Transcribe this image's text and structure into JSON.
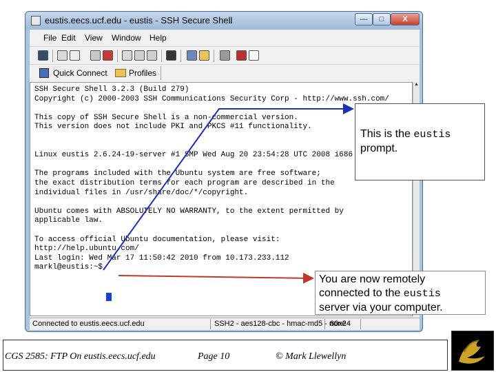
{
  "window": {
    "title": "eustis.eecs.ucf.edu - eustis - SSH Secure Shell",
    "minimize": "—",
    "maximize": "□",
    "close": "X"
  },
  "menu": [
    "File",
    "Edit",
    "View",
    "Window",
    "Help"
  ],
  "toolbar_icons": [
    "save-icon",
    "print-icon",
    "print-preview-icon",
    "search-icon",
    "shield-icon",
    "copy-icon",
    "paste-icon",
    "paste-special-icon",
    "binoculars-icon",
    "settings-icon",
    "folder-icon",
    "key-icon",
    "help-book-icon",
    "whats-this-icon"
  ],
  "linkbar": {
    "quick_connect": "Quick Connect",
    "profiles": "Profiles"
  },
  "terminal": {
    "text": "SSH Secure Shell 3.2.3 (Build 279)\nCopyright (c) 2000-2003 SSH Communications Security Corp - http://www.ssh.com/\n\nThis copy of SSH Secure Shell is a non-commercial version.\nThis version does not include PKI and PKCS #11 functionality.\n\n\nLinux eustis 2.6.24-19-server #1 SMP Wed Aug 20 23:54:28 UTC 2008 i686\n\nThe programs included with the Ubuntu system are free software;\nthe exact distribution terms for each program are described in the\nindividual files in /usr/share/doc/*/copyright.\n\nUbuntu comes with ABSOLUTELY NO WARRANTY, to the extent permitted by\napplicable law.\n\nTo access official Ubuntu documentation, please visit:\nhttp://help.ubuntu.com/\nLast login: Wed Mar 17 11:50:42 2010 from 10.173.233.112\nmarkl@eustis:~$"
  },
  "status": {
    "connected": "Connected to eustis.eecs.ucf.edu",
    "protocol": "SSH2 - aes128-cbc - hmac-md5 - none",
    "size": "80x24"
  },
  "callouts": {
    "prompt_pre": "This is the ",
    "prompt_code": "eustis",
    "prompt_post": "prompt.",
    "remote_line1": "You are now remotely",
    "remote_line2_pre": "connected to the ",
    "remote_line2_code": "eustis",
    "remote_line3": "server via your computer."
  },
  "footer": {
    "course": "CGS 2585: FTP On eustis.eecs.ucf.edu",
    "page": "Page 10",
    "author": "© Mark Llewellyn"
  },
  "colors": {
    "arrow_blue": "#1c2fb8",
    "arrow_red": "#c0392b",
    "cursor": "#1c3fd8"
  }
}
